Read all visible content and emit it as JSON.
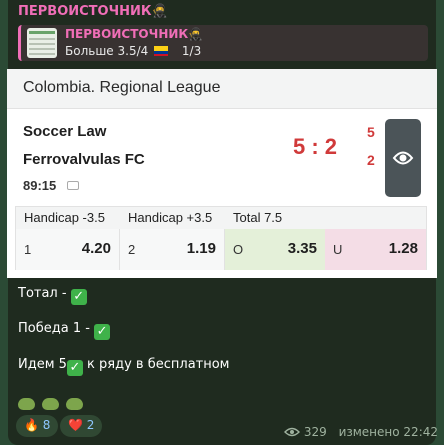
{
  "channel": {
    "sender_name": "ПЕРВОИСТОЧНИК",
    "sender_emoji": "🥷",
    "accent_color": "#f06eb7"
  },
  "reply": {
    "title": "ПЕРВОИСТОЧНИК",
    "title_emoji": "🥷",
    "text": "Больше 3.5/4",
    "counter": "1/3",
    "flag_icon": "colombia-flag-icon"
  },
  "match": {
    "league": "Colombia. Regional League",
    "home_team": "Soccer Law",
    "away_team": "Ferrovalvulas FC",
    "score": "5 : 2",
    "home_score": "5",
    "away_score": "2",
    "time": "89:15",
    "score_color": "#d03a3a",
    "markets": [
      {
        "header": "Handicap -3.5",
        "label": "1",
        "value": "4.20"
      },
      {
        "header": "Handicap +3.5",
        "label": "2",
        "value": "1.19"
      },
      {
        "header": "Total 7.5",
        "label": "O",
        "value": "3.35"
      },
      {
        "header": "",
        "label": "U",
        "value": "1.28"
      }
    ]
  },
  "message": {
    "line1": "Тотал - ",
    "line2": "Победа 1 - ",
    "line3_a": "Идем 5",
    "line3_b": " к ряду в бесплатном"
  },
  "reactions": [
    {
      "emoji": "🔥",
      "icon": "fire-icon",
      "count": "8"
    },
    {
      "emoji": "❤️",
      "icon": "heart-icon",
      "count": "2"
    }
  ],
  "meta": {
    "views": "329",
    "edited_label": "изменено",
    "time": "22:42"
  }
}
